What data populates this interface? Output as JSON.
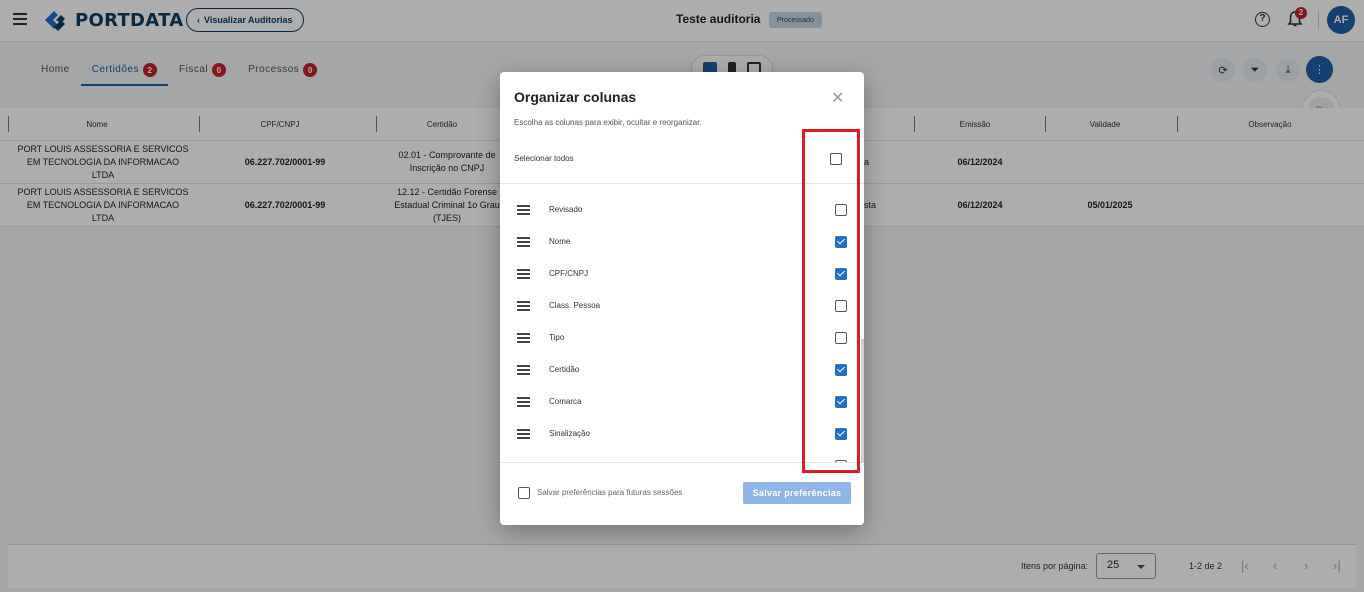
{
  "app": {
    "brand": "PORTDATA",
    "back_label": "Visualizar Auditorias",
    "page_title": "Teste auditoria",
    "status": "Processado",
    "notification_count": "2",
    "user_initials": "AF"
  },
  "tabs": [
    {
      "label": "Home",
      "count": ""
    },
    {
      "label": "Certidões",
      "count": "2"
    },
    {
      "label": "Fiscal",
      "count": "0"
    },
    {
      "label": "Processos",
      "count": "0"
    }
  ],
  "table": {
    "headers": [
      "Nome",
      "CPF/CNPJ",
      "Certidão",
      "Emissão",
      "Validade",
      "Observação"
    ],
    "rows": [
      {
        "nome": [
          "PORT LOUIS ASSESSORIA E SERVICOS",
          "EM TECNOLOGIA DA INFORMACAO",
          "LTDA"
        ],
        "cnpj": "06.227.702/0001-99",
        "certidao": [
          "02.01 - Comprovante de",
          "Inscrição no CNPJ"
        ],
        "sinal": "da",
        "emissao": "06/12/2024",
        "validade": ""
      },
      {
        "nome": [
          "PORT LOUIS ASSESSORIA E SERVICOS",
          "EM TECNOLOGIA DA INFORMACAO",
          "LTDA"
        ],
        "cnpj": "06.227.702/0001-99",
        "certidao": [
          "12.12 - Certidão Forense",
          "Estadual Criminal 1o Grau",
          "(TJES)"
        ],
        "sinal": "nsta",
        "emissao": "06/12/2024",
        "validade": "05/01/2025"
      }
    ]
  },
  "footer": {
    "items_per_page_label": "Itens por página:",
    "items_per_page": "25",
    "range": "1-2 de 2"
  },
  "dialog": {
    "title": "Organizar colunas",
    "subtitle": "Escolha as colunas para exibir, ocultar e reorganizar.",
    "select_all_label": "Selecionar todos",
    "columns": [
      {
        "label": "Revisado",
        "checked": false
      },
      {
        "label": "Nome",
        "checked": true
      },
      {
        "label": "CPF/CNPJ",
        "checked": true
      },
      {
        "label": "Class. Pessoa",
        "checked": false
      },
      {
        "label": "Tipo",
        "checked": false
      },
      {
        "label": "Certidão",
        "checked": true
      },
      {
        "label": "Comarca",
        "checked": true
      },
      {
        "label": "Sinalização",
        "checked": true
      }
    ],
    "save_pref_label": "Salvar preferências para futuras sessões",
    "save_button": "Salvar preferências"
  },
  "colors": {
    "primary": "#1f5fa8",
    "badge": "#c8202f",
    "highlight": "#e01b24"
  }
}
